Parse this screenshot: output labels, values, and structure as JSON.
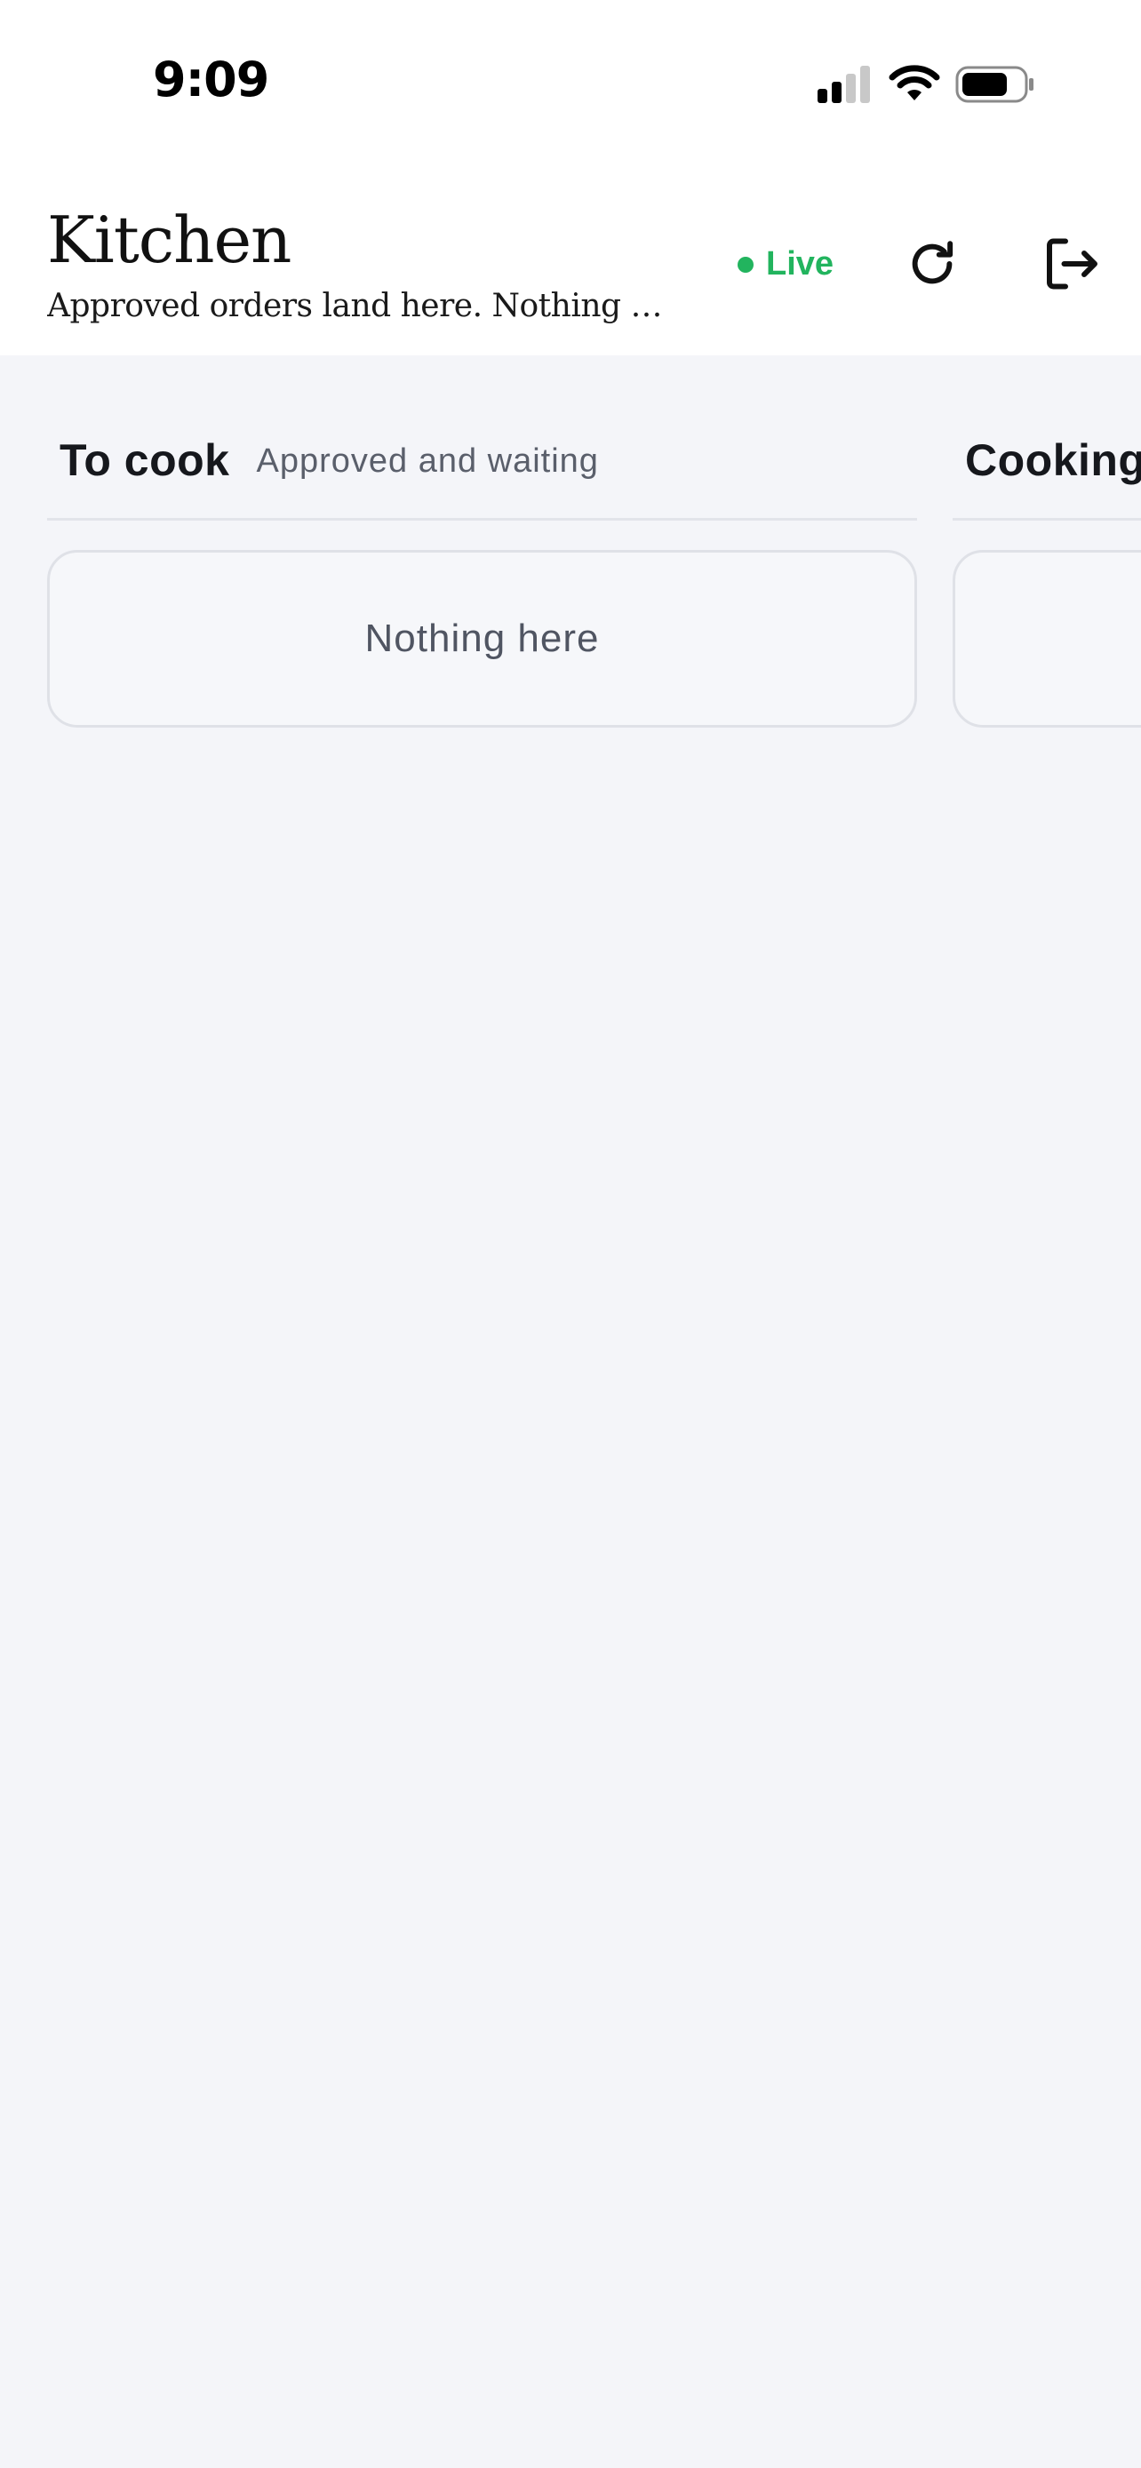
{
  "status_bar": {
    "time": "9:09",
    "icons": [
      "cellular-signal-icon",
      "wifi-icon",
      "battery-icon"
    ]
  },
  "header": {
    "title": "Kitchen",
    "subtitle": "Approved orders land here. Nothing goes to the kitchen until approved.",
    "live_label": "Live",
    "live_color": "#22b45e",
    "refresh_icon": "refresh-icon",
    "logout_icon": "logout-icon"
  },
  "columns": [
    {
      "title": "To cook",
      "subtitle": "Approved and waiting",
      "empty_text": "Nothing here"
    },
    {
      "title": "Cooking",
      "subtitle": "",
      "empty_text": ""
    }
  ]
}
